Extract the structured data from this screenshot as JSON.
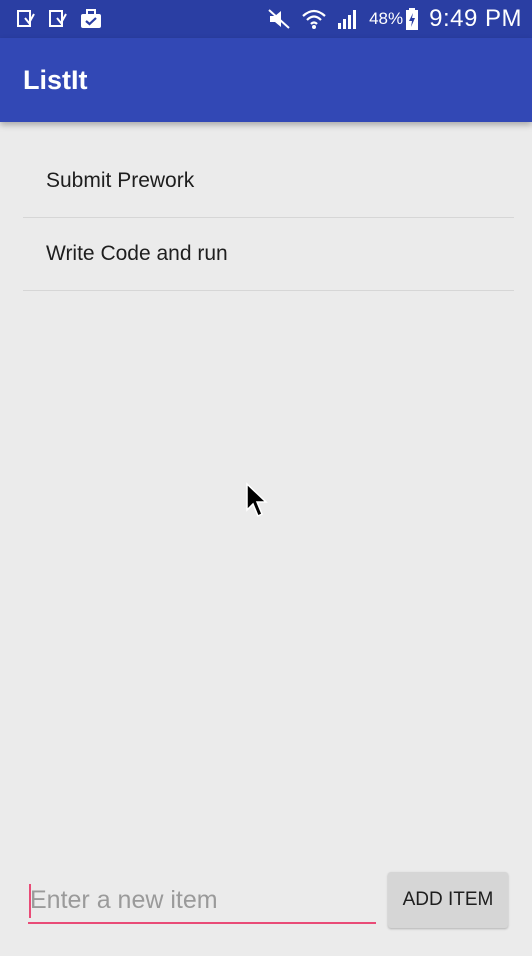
{
  "status_bar": {
    "left_icons": [
      "download-done-icon",
      "download-check-icon",
      "briefcase-check-icon"
    ],
    "right_icons": [
      "mute-icon",
      "wifi-icon",
      "signal-icon"
    ],
    "battery": "48%",
    "time": "9:49 PM",
    "background": "#2a3ea3"
  },
  "app_bar": {
    "title": "ListIt",
    "background": "#3248b5"
  },
  "list": {
    "items": [
      {
        "label": "Submit Prework"
      },
      {
        "label": "Write Code and run"
      }
    ]
  },
  "composer": {
    "placeholder": "Enter a new item",
    "value": "",
    "add_button_label": "ADD ITEM",
    "accent": "#e94b77"
  }
}
